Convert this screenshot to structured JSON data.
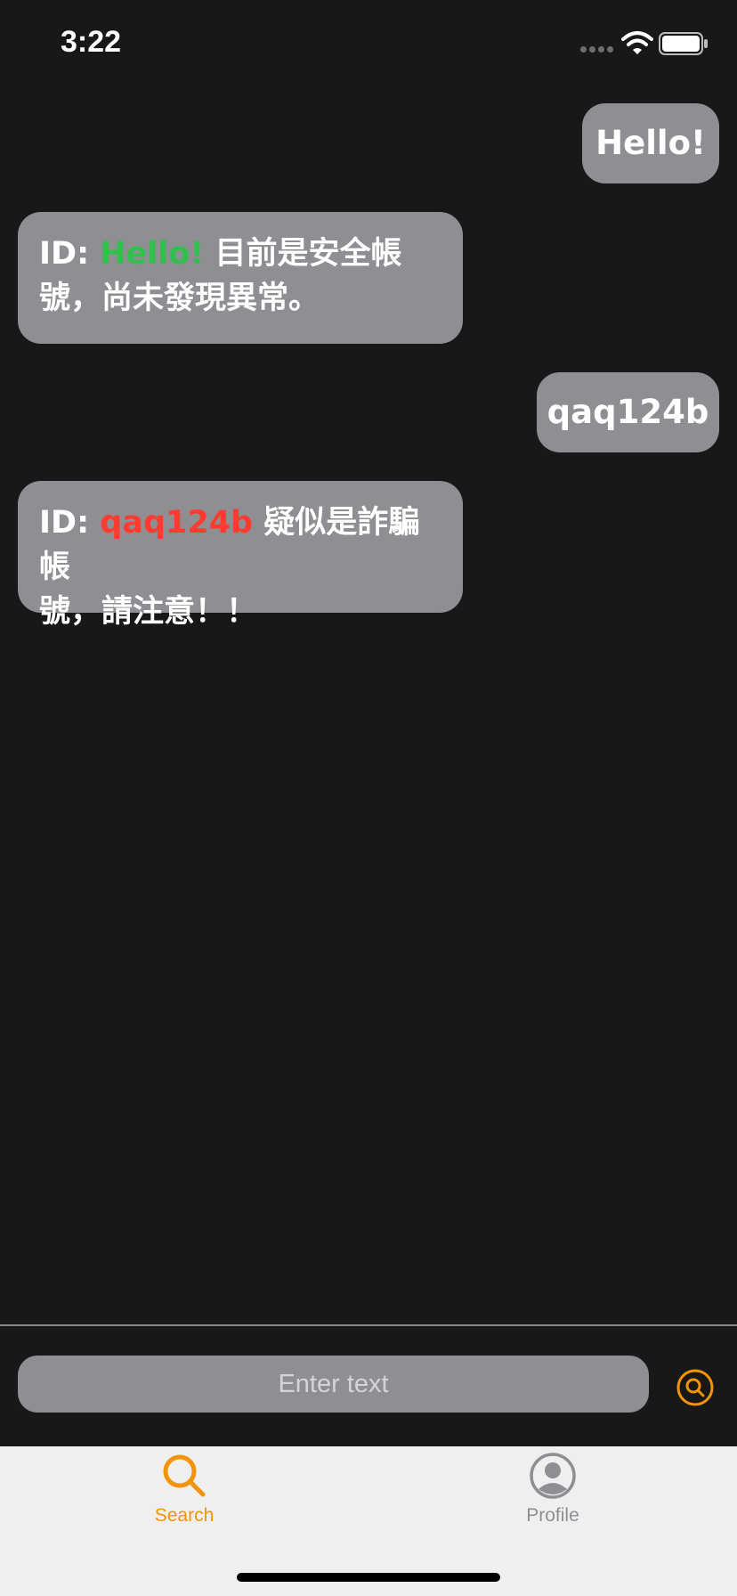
{
  "status_bar": {
    "time": "3:22",
    "wifi_icon": "wifi-icon",
    "battery_icon": "battery-icon",
    "signal_icon": "signal-dots-icon"
  },
  "messages": [
    {
      "direction": "outgoing",
      "text": "Hello!"
    },
    {
      "direction": "incoming",
      "prefix": "ID: ",
      "id": "Hello!",
      "id_color": "#30c04b",
      "text_line1": " 目前是安全帳",
      "text_line2": "號，尚未發現異常。"
    },
    {
      "direction": "outgoing",
      "text": "qaq124b"
    },
    {
      "direction": "incoming",
      "prefix": "ID: ",
      "id": "qaq124b",
      "id_color": "#ff3b30",
      "text_line1": " 疑似是詐騙帳",
      "text_line2": "號，請注意！！"
    }
  ],
  "input": {
    "placeholder": "Enter text",
    "submit_icon": "search-icon"
  },
  "tab_bar": {
    "tabs": [
      {
        "label": "Search",
        "icon": "search-icon",
        "selected": true
      },
      {
        "label": "Profile",
        "icon": "profile-icon",
        "selected": false
      }
    ]
  },
  "colors": {
    "background": "#181818",
    "bubble": "#8e8e93",
    "accent": "#f2940a",
    "safe": "#30c04b",
    "danger": "#ff3b30"
  }
}
